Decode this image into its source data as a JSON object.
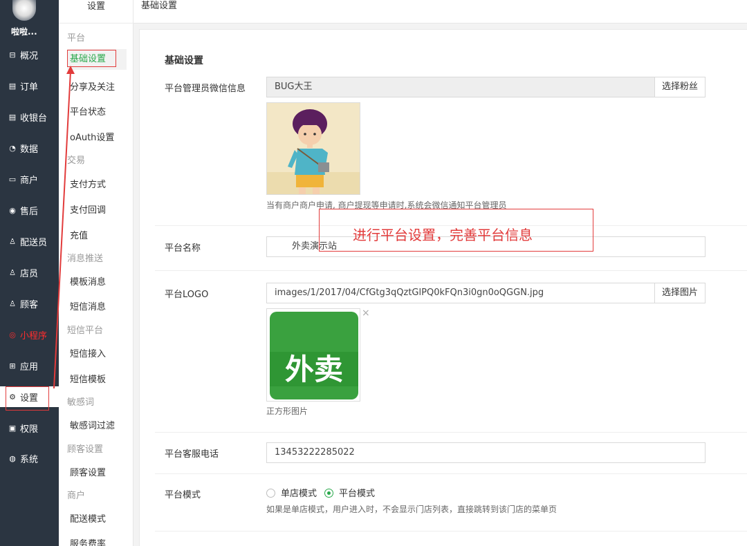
{
  "nav": {
    "user_name": "啦啦...",
    "items": [
      {
        "label": "概况",
        "icon": "dashboard-icon",
        "glyph": "⊟"
      },
      {
        "label": "订单",
        "icon": "order-icon",
        "glyph": "▤"
      },
      {
        "label": "收银台",
        "icon": "cashier-icon",
        "glyph": "▤"
      },
      {
        "label": "数据",
        "icon": "chart-icon",
        "glyph": "◔"
      },
      {
        "label": "商户",
        "icon": "store-icon",
        "glyph": "▭"
      },
      {
        "label": "售后",
        "icon": "aftersale-icon",
        "glyph": "◉"
      },
      {
        "label": "配送员",
        "icon": "courier-icon",
        "glyph": "♙"
      },
      {
        "label": "店员",
        "icon": "clerk-icon",
        "glyph": "♙"
      },
      {
        "label": "顾客",
        "icon": "customer-icon",
        "glyph": "♙"
      },
      {
        "label": "小程序",
        "icon": "miniprogram-icon",
        "glyph": "◎"
      },
      {
        "label": "应用",
        "icon": "apps-icon",
        "glyph": "⊞"
      },
      {
        "label": "设置",
        "icon": "gear-icon",
        "glyph": "⚙"
      },
      {
        "label": "权限",
        "icon": "lock-icon",
        "glyph": "▣"
      },
      {
        "label": "系统",
        "icon": "system-icon",
        "glyph": "◍"
      }
    ]
  },
  "submenu": {
    "title": "设置",
    "groups": {
      "platform": "平台",
      "trade": "交易",
      "push": "消息推送",
      "sms": "短信平台",
      "sensitive": "敏感词",
      "customer": "顾客设置",
      "merchant": "商户"
    },
    "items": {
      "basic": "基础设置",
      "share": "分享及关注",
      "status": "平台状态",
      "oauth": "oAuth设置",
      "pay_method": "支付方式",
      "pay_callback": "支付回调",
      "recharge": "充值",
      "template_msg": "模板消息",
      "sms_msg": "短信消息",
      "sms_access": "短信接入",
      "sms_template": "短信模板",
      "sensitive_filter": "敏感词过滤",
      "customer_setting": "顾客设置",
      "delivery_mode": "配送模式",
      "service_rate": "服务费率"
    }
  },
  "header": {
    "breadcrumb": "基础设置"
  },
  "form": {
    "section_title": "基础设置",
    "admin": {
      "label": "平台管理员微信信息",
      "value": "BUG大王",
      "button": "选择粉丝",
      "help": "当有商户商户申请, 商户提现等申请时,系统会微信通知平台管理员"
    },
    "name": {
      "label": "平台名称",
      "value": "外卖演示站"
    },
    "logo": {
      "label": "平台LOGO",
      "value": "images/1/2017/04/CfGtg3qQztGlPQ0kFQn3i0gn0oQGGN.jpg",
      "button": "选择图片",
      "remove": "×",
      "logo_text": "外卖",
      "help": "正方形图片"
    },
    "phone": {
      "label": "平台客服电话",
      "value": "13453222285022"
    },
    "mode": {
      "label": "平台模式",
      "options": [
        "单店模式",
        "平台模式"
      ],
      "selected": "平台模式",
      "help": "如果是单店模式，用户进入时，不会显示门店列表，直接跳转到该门店的菜单页"
    }
  },
  "annotation": {
    "text": "进行平台设置，完善平台信息"
  },
  "colors": {
    "accent_green": "#29a84b",
    "nav_bg": "#2b3541",
    "annotation_red": "#e23b3b"
  }
}
